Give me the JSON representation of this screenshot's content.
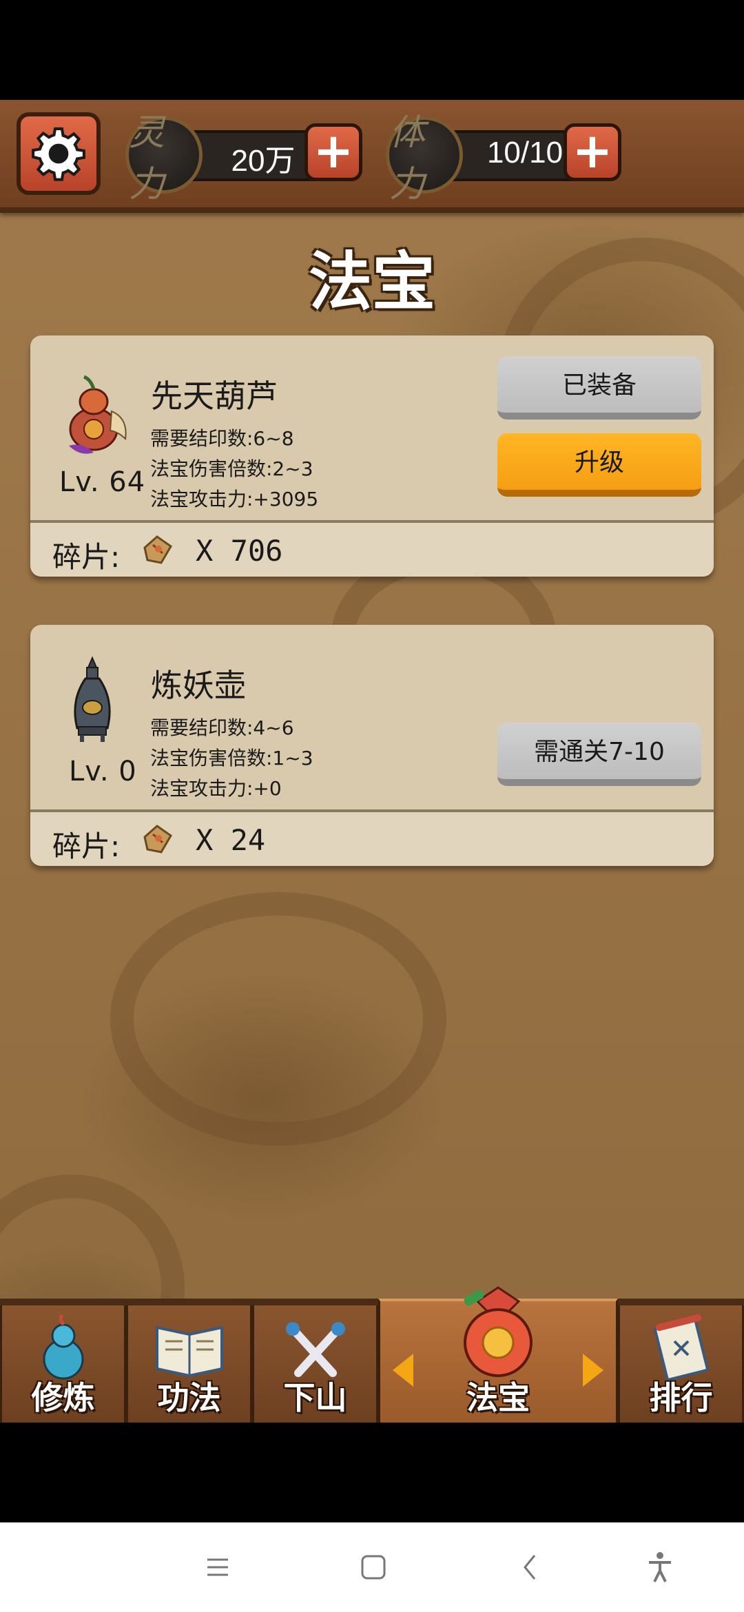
{
  "topbar": {
    "spirit": {
      "badge": "灵力",
      "value": "20万"
    },
    "stamina": {
      "badge": "体力",
      "value": "10/10"
    }
  },
  "page": {
    "title": "法宝"
  },
  "treasures": [
    {
      "name": "先天葫芦",
      "level": "Lv. 64",
      "stats": [
        "需要结印数:6~8",
        "法宝伤害倍数:2~3",
        "法宝攻击力:+3095"
      ],
      "buttons": [
        "已装备",
        "升级"
      ],
      "fragment_label": "碎片:",
      "fragment_count": "X  706"
    },
    {
      "name": "炼妖壶",
      "level": "Lv. 0",
      "stats": [
        "需要结印数:4~6",
        "法宝伤害倍数:1~3",
        "法宝攻击力:+0"
      ],
      "buttons": [
        "需通关7-10"
      ],
      "fragment_label": "碎片:",
      "fragment_count": "X  24"
    }
  ],
  "nav": {
    "items": [
      "修炼",
      "功法",
      "下山",
      "法宝",
      "排行"
    ],
    "active": "法宝"
  },
  "colors": {
    "accent_orange": "#f59e14",
    "button_red": "#c8502f",
    "wood": "#6f3f1f"
  }
}
